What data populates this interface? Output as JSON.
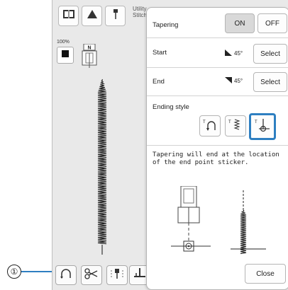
{
  "callout": {
    "number": "①"
  },
  "screen": {
    "utility_label": "Utility Stitch",
    "zoom": "100%",
    "icons": {
      "stitch_book": "book-icon",
      "shape": "triangle-icon",
      "needle": "needle-icon",
      "thread_color": "thread-color-icon"
    },
    "bottom_buttons": [
      {
        "name": "tapering-button",
        "icon": "arc-icon"
      },
      {
        "name": "thread-cutter-button",
        "icon": "scissors-icon"
      },
      {
        "name": "needle-position-button",
        "icon": "needle-position-icon"
      },
      {
        "name": "presser-foot-button",
        "icon": "presser-foot-icon"
      }
    ]
  },
  "panel": {
    "tapering_label": "Tapering",
    "toggle_on": "ON",
    "toggle_off": "OFF",
    "start_label": "Start",
    "start_angle": "45°",
    "start_select": "Select",
    "end_label": "End",
    "end_angle": "45°",
    "end_select": "Select",
    "ending_style_label": "Ending style",
    "ending_styles": [
      {
        "name": "end-style-reverse-arc",
        "icon": "reverse-arc-icon",
        "selected": false
      },
      {
        "name": "end-style-stitch-count",
        "icon": "stitch-count-icon",
        "selected": false
      },
      {
        "name": "end-style-sticker",
        "icon": "end-point-sticker-icon",
        "selected": true
      }
    ],
    "note": "Tapering will end at the location of the end point sticker.",
    "close_label": "Close"
  },
  "colors": {
    "accent": "#2e7fc1",
    "screen_bg": "#e9e9e9",
    "panel_bg": "#ffffff"
  }
}
